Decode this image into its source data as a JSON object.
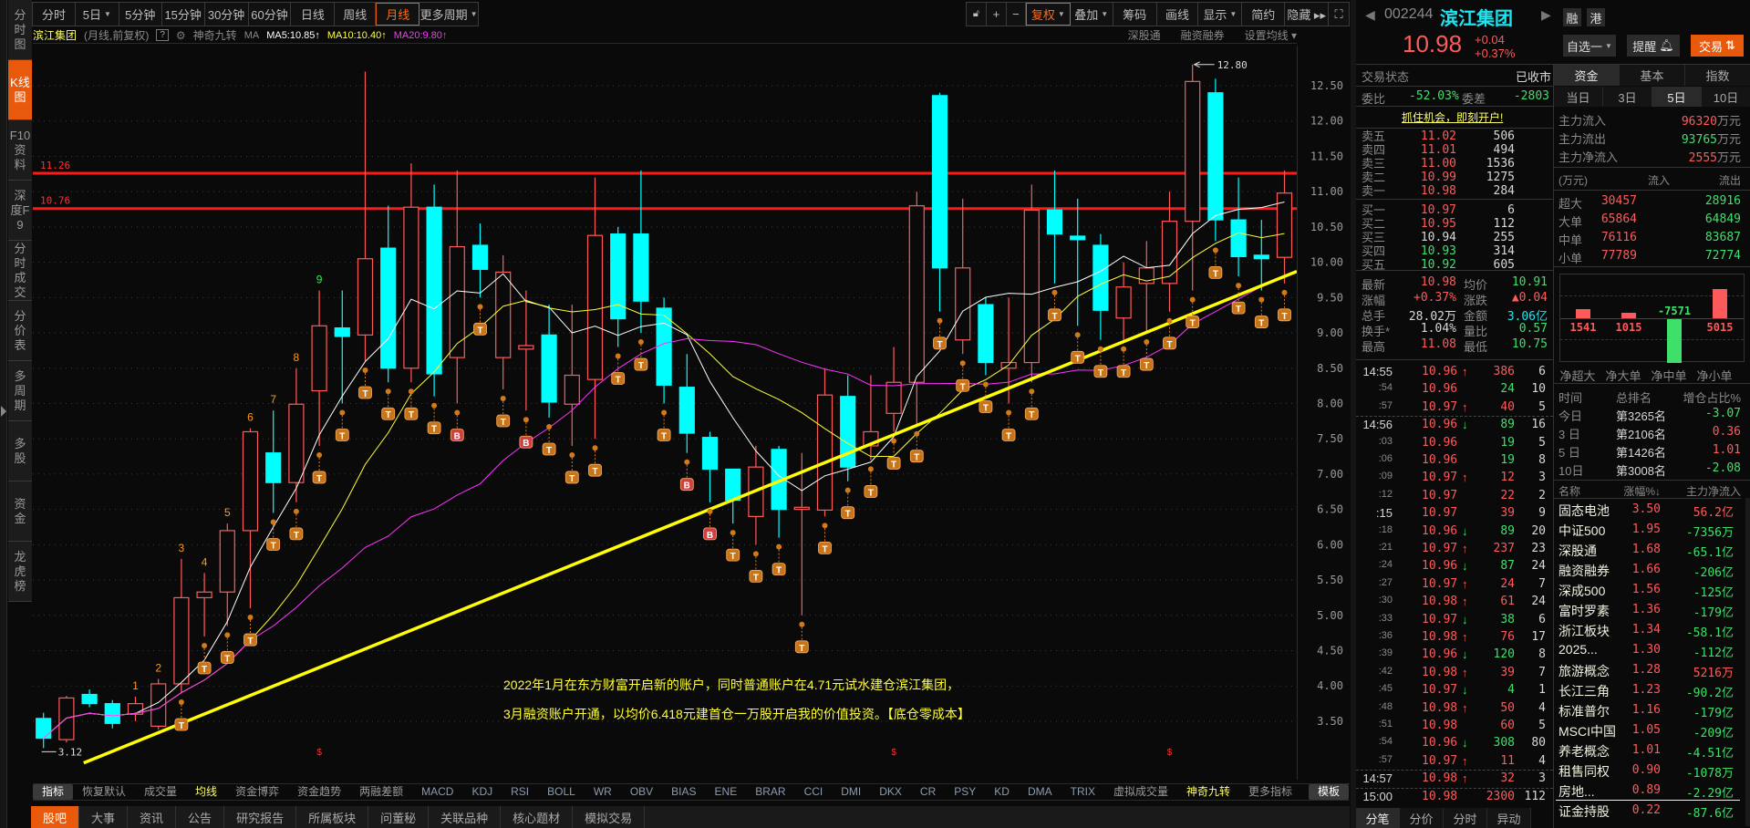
{
  "sidebar": {
    "items": [
      "分时图",
      "K线图",
      "F10资料",
      "深度F9",
      "分时成交",
      "分价表",
      "多周期",
      "多股",
      "资金",
      "龙虎榜"
    ],
    "active": 1
  },
  "toolbar": {
    "periods": [
      {
        "label": "分时"
      },
      {
        "label": "5日",
        "caret": true
      },
      {
        "label": "5分钟"
      },
      {
        "label": "15分钟"
      },
      {
        "label": "30分钟"
      },
      {
        "label": "60分钟"
      },
      {
        "label": "日线"
      },
      {
        "label": "周线"
      },
      {
        "label": "月线",
        "active": true
      },
      {
        "label": "更多周期",
        "caret": true
      }
    ],
    "tools": [
      {
        "label": "",
        "icon": "lock-icon"
      },
      {
        "label": "+",
        "icon": "zoom-in-icon"
      },
      {
        "label": "−",
        "icon": "zoom-out-icon"
      },
      {
        "label": "复权",
        "caret": true,
        "active": true
      },
      {
        "label": "叠加",
        "caret": true
      },
      {
        "label": "筹码"
      },
      {
        "label": "画线"
      },
      {
        "label": "显示",
        "caret": true
      },
      {
        "label": "简约"
      },
      {
        "label": "隐藏 ▸▸"
      },
      {
        "label": "",
        "icon": "fullscreen-icon"
      }
    ]
  },
  "chart_header": {
    "name": "滨江集团",
    "mode": "(月线,前复权)",
    "help": "?",
    "indicator": "神奇九转",
    "ma_label": "MA",
    "ma": [
      {
        "text": "MA5:10.85",
        "arrow": "↑",
        "color": "#ffffff"
      },
      {
        "text": "MA10:10.40",
        "arrow": "↑",
        "color": "#ffff33"
      },
      {
        "text": "MA20:9.80",
        "arrow": "↑",
        "color": "#ff33ff"
      }
    ],
    "right": [
      "深股通",
      "融资融券",
      "设置均线 ▾"
    ]
  },
  "chart_data": {
    "type": "candlestick",
    "title": "滨江集团",
    "period": "月线",
    "adjust": "前复权",
    "ylim": [
      3.0,
      13.0
    ],
    "yticks": [
      "12.50",
      "12.00",
      "11.50",
      "11.00",
      "10.50",
      "10.00",
      "9.50",
      "9.00",
      "8.50",
      "8.00",
      "7.50",
      "7.00",
      "6.50",
      "6.00",
      "5.50",
      "5.00",
      "4.50",
      "4.00",
      "3.50"
    ],
    "up_color": "#ff5a5a",
    "down_color": "#00ffff",
    "candles": [
      [
        3.54,
        3.62,
        3.12,
        3.26
      ],
      [
        3.24,
        3.86,
        3.2,
        3.83
      ],
      [
        3.88,
        3.95,
        3.7,
        3.75
      ],
      [
        3.75,
        3.8,
        3.4,
        3.47
      ],
      [
        3.6,
        3.85,
        3.5,
        3.75
      ],
      [
        3.43,
        4.1,
        3.38,
        4.03
      ],
      [
        4.03,
        5.8,
        3.9,
        5.25
      ],
      [
        5.25,
        5.6,
        4.7,
        5.33
      ],
      [
        5.33,
        6.3,
        4.85,
        6.2
      ],
      [
        6.2,
        7.65,
        5.1,
        7.6
      ],
      [
        7.3,
        7.9,
        6.45,
        6.88
      ],
      [
        6.88,
        8.5,
        6.6,
        7.99
      ],
      [
        8.18,
        9.6,
        7.4,
        9.1
      ],
      [
        9.07,
        9.6,
        8.0,
        8.95
      ],
      [
        8.97,
        12.7,
        8.6,
        10.05
      ],
      [
        10.2,
        10.8,
        8.3,
        8.5
      ],
      [
        8.5,
        11.4,
        8.3,
        10.78
      ],
      [
        10.78,
        11.1,
        8.1,
        8.42
      ],
      [
        8.65,
        11.3,
        8.0,
        10.22
      ],
      [
        10.24,
        10.55,
        9.5,
        9.9
      ],
      [
        8.65,
        10.1,
        8.2,
        9.86
      ],
      [
        8.77,
        9.6,
        7.9,
        8.82
      ],
      [
        8.97,
        9.4,
        7.8,
        8.02
      ],
      [
        7.99,
        9.4,
        7.4,
        8.4
      ],
      [
        8.34,
        11.2,
        7.5,
        10.38
      ],
      [
        10.4,
        10.5,
        8.8,
        9.2
      ],
      [
        10.4,
        11.3,
        9.0,
        9.45
      ],
      [
        9.35,
        9.5,
        8.0,
        8.26
      ],
      [
        8.23,
        8.7,
        7.3,
        7.58
      ],
      [
        7.52,
        7.6,
        6.6,
        7.07
      ],
      [
        7.07,
        7.07,
        6.3,
        6.63
      ],
      [
        6.4,
        7.4,
        6.0,
        7.1
      ],
      [
        7.35,
        7.4,
        6.1,
        6.5
      ],
      [
        6.5,
        7.3,
        5.0,
        6.53
      ],
      [
        6.49,
        8.5,
        6.4,
        8.12
      ],
      [
        8.1,
        8.4,
        6.9,
        7.1
      ],
      [
        7.4,
        8.4,
        7.2,
        7.6
      ],
      [
        7.86,
        8.8,
        7.6,
        8.3
      ],
      [
        8.3,
        11.0,
        7.7,
        10.8
      ],
      [
        12.36,
        12.4,
        9.3,
        9.92
      ],
      [
        8.9,
        10.9,
        8.7,
        9.92
      ],
      [
        9.4,
        9.5,
        8.4,
        8.58
      ],
      [
        8.5,
        9.5,
        8.0,
        8.58
      ],
      [
        8.58,
        11.1,
        8.3,
        10.74
      ],
      [
        10.74,
        11.3,
        9.7,
        10.4
      ],
      [
        10.37,
        10.9,
        9.1,
        10.32
      ],
      [
        10.24,
        10.4,
        8.9,
        9.32
      ],
      [
        9.21,
        10.0,
        8.9,
        9.65
      ],
      [
        9.7,
        10.3,
        9.0,
        9.92
      ],
      [
        9.7,
        11.0,
        9.3,
        10.58
      ],
      [
        10.58,
        12.8,
        9.6,
        12.56
      ],
      [
        12.4,
        12.6,
        10.3,
        10.6
      ],
      [
        10.6,
        11.2,
        9.8,
        10.08
      ],
      [
        10.1,
        10.6,
        9.6,
        10.05
      ],
      [
        10.07,
        11.3,
        9.7,
        10.98
      ]
    ],
    "ma_series": [
      {
        "name": "MA5",
        "period": 5,
        "color": "#ffffff"
      },
      {
        "name": "MA10",
        "period": 10,
        "color": "#ffff33"
      },
      {
        "name": "MA20",
        "period": 20,
        "color": "#ff33ff"
      }
    ],
    "hlines": [
      {
        "value": 11.26,
        "label": "11.26",
        "color": "#ff1a1a"
      },
      {
        "value": 10.76,
        "label": "10.76",
        "color": "#ff1a1a"
      }
    ],
    "trendline": {
      "from": [
        1.75,
        2.91
      ],
      "to": [
        55.5,
        9.87
      ],
      "color": "#ffff00"
    },
    "high_label": {
      "index": 50,
      "value": 12.8,
      "text": "12.80"
    },
    "low_label": {
      "index": 0,
      "value": 3.12,
      "text": "3.12"
    },
    "nine_turn": [
      {
        "index": 4,
        "n": "1"
      },
      {
        "index": 5,
        "n": "2"
      },
      {
        "index": 6,
        "n": "3"
      },
      {
        "index": 7,
        "n": "4"
      },
      {
        "index": 8,
        "n": "5"
      },
      {
        "index": 9,
        "n": "6"
      },
      {
        "index": 10,
        "n": "7"
      },
      {
        "index": 11,
        "n": "8"
      },
      {
        "index": 12,
        "n": "9"
      }
    ],
    "b_markers": [
      18,
      21,
      28,
      29
    ],
    "t_marker_start": 6,
    "events": [
      12,
      37,
      49
    ],
    "annotation": [
      "2022年1月在东方财富开启新的账户，同时普通账户在4.71元试水建仓滨江集团，",
      "3月融资账户开通，以均价6.418元建首仓一万股开启我的价值投资。【底仓零成本】"
    ]
  },
  "indicators": {
    "items": [
      "指标",
      "恢复默认",
      "成交量",
      "均线",
      "资金博弈",
      "资金趋势",
      "两融差额",
      "MACD",
      "KDJ",
      "RSI",
      "BOLL",
      "WR",
      "OBV",
      "BIAS",
      "ENE",
      "BRAR",
      "CCI",
      "DMI",
      "DKX",
      "CR",
      "PSY",
      "KD",
      "DMA",
      "TRIX",
      "虚拟成交量",
      "神奇九转",
      "更多指标",
      "模板"
    ],
    "selected": [
      "指标",
      "模板"
    ],
    "highlighted": [
      "均线",
      "神奇九转"
    ]
  },
  "bottom_tabs": {
    "items": [
      "股吧",
      "大事",
      "资讯",
      "公告",
      "研究报告",
      "所属板块",
      "问董秘",
      "关联品种",
      "核心题材",
      "模拟交易"
    ],
    "active": 0
  },
  "quote": {
    "code": "002244",
    "name": "滨江集团",
    "badges": [
      "融",
      "港"
    ],
    "price": "10.98",
    "change": "+0.04",
    "change_pct": "+0.37%",
    "watch_button": "自选一",
    "alert_button": "提醒",
    "trade_button": "交易",
    "status_label": "交易状态",
    "status": "已收市",
    "weibi_label": "委比",
    "weibi": "-52.03%",
    "weicha_label": "委差",
    "weicha": "-2803",
    "promo": "抓住机会，即刻开户!",
    "book": [
      {
        "label": "卖五",
        "price": "11.02",
        "vol": "506",
        "dir": "red"
      },
      {
        "label": "卖四",
        "price": "11.01",
        "vol": "494",
        "dir": "red"
      },
      {
        "label": "卖三",
        "price": "11.00",
        "vol": "1536",
        "dir": "red"
      },
      {
        "label": "卖二",
        "price": "10.99",
        "vol": "1275",
        "dir": "red"
      },
      {
        "label": "卖一",
        "price": "10.98",
        "vol": "284",
        "dir": "red"
      },
      {
        "label": "买一",
        "price": "10.97",
        "vol": "6",
        "dir": "red"
      },
      {
        "label": "买二",
        "price": "10.95",
        "vol": "112",
        "dir": "red"
      },
      {
        "label": "买三",
        "price": "10.94",
        "vol": "255",
        "dir": "wht"
      },
      {
        "label": "买四",
        "price": "10.93",
        "vol": "314",
        "dir": "grn"
      },
      {
        "label": "买五",
        "price": "10.92",
        "vol": "605",
        "dir": "grn"
      }
    ],
    "stats": [
      [
        {
          "label": "最新",
          "value": "10.98",
          "c": "red"
        },
        {
          "label": "均价",
          "value": "10.91",
          "c": "grn"
        }
      ],
      [
        {
          "label": "涨幅",
          "value": "+0.37%",
          "c": "red"
        },
        {
          "label": "涨跌",
          "value": "▲0.04",
          "c": "red"
        }
      ],
      [
        {
          "label": "总手",
          "value": "28.02万",
          "c": "wht"
        },
        {
          "label": "金额",
          "value": "3.06亿",
          "c": "cyan"
        }
      ],
      [
        {
          "label": "换手*",
          "value": "1.04%",
          "c": "wht"
        },
        {
          "label": "量比",
          "value": "0.57",
          "c": "grn"
        }
      ],
      [
        {
          "label": "最高",
          "value": "11.08",
          "c": "red"
        },
        {
          "label": "最低",
          "value": "10.75",
          "c": "grn"
        }
      ]
    ]
  },
  "ticks": [
    [
      "14:55",
      "10.96",
      "↑",
      "386",
      "6",
      "red"
    ],
    [
      ":54",
      "10.96",
      "",
      "24",
      "10",
      "grn"
    ],
    [
      ":57",
      "10.97",
      "↑",
      "40",
      "5",
      "red"
    ],
    [
      "14:56",
      "10.96",
      "↓",
      "89",
      "16",
      "grn"
    ],
    [
      ":03",
      "10.96",
      "",
      "19",
      "5",
      "grn"
    ],
    [
      ":06",
      "10.96",
      "",
      "19",
      "8",
      "grn"
    ],
    [
      ":09",
      "10.97",
      "↑",
      "12",
      "3",
      "red"
    ],
    [
      ":12",
      "10.97",
      "",
      "22",
      "2",
      "red"
    ],
    [
      ":15",
      "10.97",
      "",
      "39",
      "9",
      "red"
    ],
    [
      ":18",
      "10.96",
      "↓",
      "89",
      "20",
      "grn"
    ],
    [
      ":21",
      "10.97",
      "↑",
      "237",
      "23",
      "red"
    ],
    [
      ":24",
      "10.96",
      "↓",
      "87",
      "24",
      "grn"
    ],
    [
      ":27",
      "10.97",
      "↑",
      "24",
      "7",
      "red"
    ],
    [
      ":30",
      "10.98",
      "↑",
      "61",
      "24",
      "red"
    ],
    [
      ":33",
      "10.97",
      "↓",
      "38",
      "6",
      "grn"
    ],
    [
      ":36",
      "10.98",
      "↑",
      "76",
      "17",
      "red"
    ],
    [
      ":39",
      "10.96",
      "↓",
      "120",
      "8",
      "grn"
    ],
    [
      ":42",
      "10.98",
      "↑",
      "39",
      "7",
      "red"
    ],
    [
      ":45",
      "10.97",
      "↓",
      "4",
      "1",
      "grn"
    ],
    [
      ":48",
      "10.98",
      "↑",
      "50",
      "4",
      "red"
    ],
    [
      ":51",
      "10.98",
      "",
      "60",
      "5",
      "red"
    ],
    [
      ":54",
      "10.96",
      "↓",
      "308",
      "80",
      "grn"
    ],
    [
      ":57",
      "10.97",
      "↑",
      "11",
      "4",
      "red"
    ],
    [
      "14:57",
      "10.98",
      "↑",
      "32",
      "3",
      "red"
    ],
    [
      "15:00",
      "10.98",
      "",
      "2300",
      "112",
      "red"
    ]
  ],
  "tick_tabs": [
    "分笔",
    "分价",
    "分时",
    "异动"
  ],
  "funds": {
    "tabs": [
      "资金",
      "基本",
      "指数"
    ],
    "period_tabs": [
      "当日",
      "3日",
      "5日",
      "10日"
    ],
    "active_period": 2,
    "main": [
      {
        "label": "主力流入",
        "value": "96320",
        "unit": "万元",
        "c": "red"
      },
      {
        "label": "主力流出",
        "value": "93765",
        "unit": "万元",
        "c": "grn"
      },
      {
        "label": "主力净流入",
        "value": "2555",
        "unit": "万元",
        "c": "red"
      }
    ],
    "table_head": [
      "(万元)",
      "流入",
      "流出"
    ],
    "rows": [
      [
        "超大",
        "30457",
        "28916"
      ],
      [
        "大单",
        "65864",
        "64849"
      ],
      [
        "中单",
        "76116",
        "83687"
      ],
      [
        "小单",
        "77789",
        "72774"
      ]
    ],
    "net": [
      {
        "label": "净超大",
        "value": 1541,
        "text": "1541"
      },
      {
        "label": "净大单",
        "value": 1015,
        "text": "1015"
      },
      {
        "label": "净中单",
        "value": -7571,
        "text": "-7571"
      },
      {
        "label": "净小单",
        "value": 5015,
        "text": "5015"
      }
    ],
    "rank_head": [
      "时间",
      "总排名",
      "增仓占比%"
    ],
    "ranks": [
      [
        "今日",
        "第3265名",
        "-3.07",
        "grn"
      ],
      [
        "3 日",
        "第2106名",
        "0.36",
        "red"
      ],
      [
        "5 日",
        "第1426名",
        "1.01",
        "red"
      ],
      [
        "10日",
        "第3008名",
        "-2.08",
        "grn"
      ]
    ]
  },
  "sectors": {
    "head": [
      "名称",
      "涨幅%↓",
      "主力净流入"
    ],
    "rows": [
      [
        "固态电池",
        "3.50",
        "56.2亿",
        "red"
      ],
      [
        "中证500",
        "1.95",
        "-7356万",
        "grn"
      ],
      [
        "深股通",
        "1.68",
        "-65.1亿",
        "grn"
      ],
      [
        "融资融券",
        "1.66",
        "-206亿",
        "grn"
      ],
      [
        "深成500",
        "1.56",
        "-125亿",
        "grn"
      ],
      [
        "富时罗素",
        "1.36",
        "-179亿",
        "grn"
      ],
      [
        "浙江板块",
        "1.34",
        "-58.1亿",
        "grn"
      ],
      [
        "2025...",
        "1.30",
        "-112亿",
        "grn"
      ],
      [
        "旅游概念",
        "1.28",
        "5216万",
        "red"
      ],
      [
        "长江三角",
        "1.23",
        "-90.2亿",
        "grn"
      ],
      [
        "标准普尔",
        "1.16",
        "-179亿",
        "grn"
      ],
      [
        "MSCI中国",
        "1.05",
        "-209亿",
        "grn"
      ],
      [
        "养老概念",
        "1.01",
        "-4.51亿",
        "grn"
      ],
      [
        "租售同权",
        "0.90",
        "-1078万",
        "grn"
      ],
      [
        "房地...",
        "0.89",
        "-2.29亿",
        "grn"
      ]
    ],
    "pinned": [
      "证金持股",
      "0.22",
      "-87.6亿",
      "grn"
    ]
  }
}
